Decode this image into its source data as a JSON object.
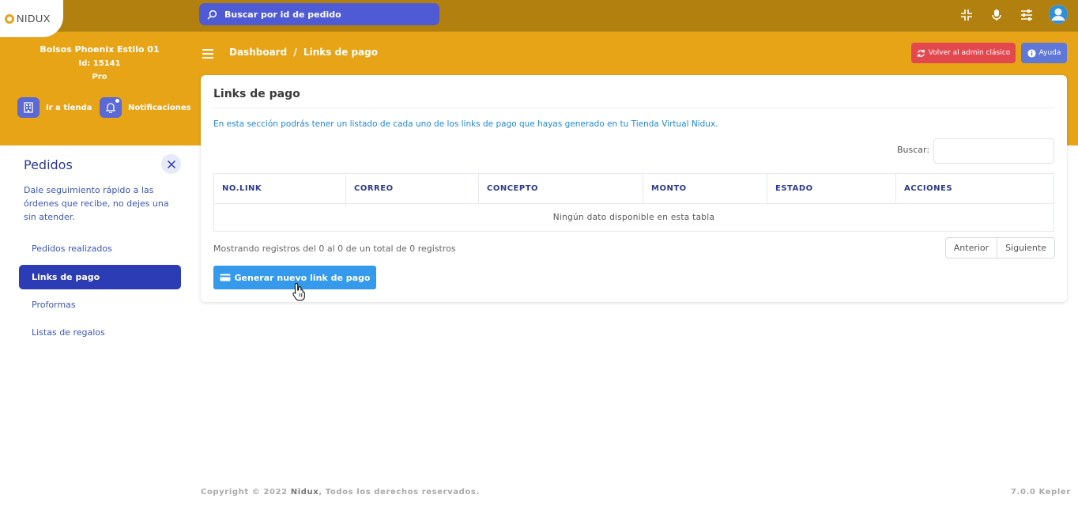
{
  "brand": {
    "logo_text": "NIDUX"
  },
  "topbar": {
    "search_placeholder": "Buscar por id de pedido",
    "icons": [
      "compress-icon",
      "microphone-icon",
      "sliders-icon",
      "user-avatar-icon"
    ]
  },
  "store": {
    "name": "Bolsos Phoenix Estilo 01",
    "id_label": "Id: 15141",
    "plan": "Pro",
    "go_store_label": "Ir a tienda",
    "notifications_label": "Notificaciones"
  },
  "header": {
    "breadcrumb_root": "Dashboard",
    "breadcrumb_sep": "/",
    "breadcrumb_current": "Links de pago",
    "classic_admin_label": "Volver al admin clásico",
    "help_label": "Ayuda"
  },
  "sidebar": {
    "title": "Pedidos",
    "description": "Dale seguimiento rápido a las órdenes que recibe, no dejes una sin atender.",
    "items": [
      {
        "label": "Pedidos realizados",
        "active": false
      },
      {
        "label": "Links de pago",
        "active": true
      },
      {
        "label": "Proformas",
        "active": false
      },
      {
        "label": "Listas de regalos",
        "active": false
      }
    ]
  },
  "card": {
    "title": "Links de pago",
    "description": "En esta sección podrás tener un listado de cada uno de los links de pago que hayas generado en tu Tienda Virtual Nidux.",
    "search_label": "Buscar:",
    "search_value": "",
    "columns": [
      "NO.LINK",
      "CORREO",
      "CONCEPTO",
      "MONTO",
      "ESTADO",
      "ACCIONES"
    ],
    "empty_message": "Ningún dato disponible en esta tabla",
    "showing_text": "Mostrando registros del 0 al 0 de un total de 0 registros",
    "prev_label": "Anterior",
    "next_label": "Siguiente",
    "generate_label": "Generar nuevo link de pago"
  },
  "footer": {
    "copyright_prefix": "Copyright © 2022 ",
    "copyright_brand": "Nidux",
    "copyright_suffix": ", Todos los derechos reservados.",
    "version": "7.0.0 Kepler"
  },
  "colors": {
    "topbar": "#b1800f",
    "band": "#e7a417",
    "primary": "#2c3cb4",
    "search": "#4f5bd5",
    "danger": "#e4484f",
    "generate_button": "#3599ec"
  }
}
